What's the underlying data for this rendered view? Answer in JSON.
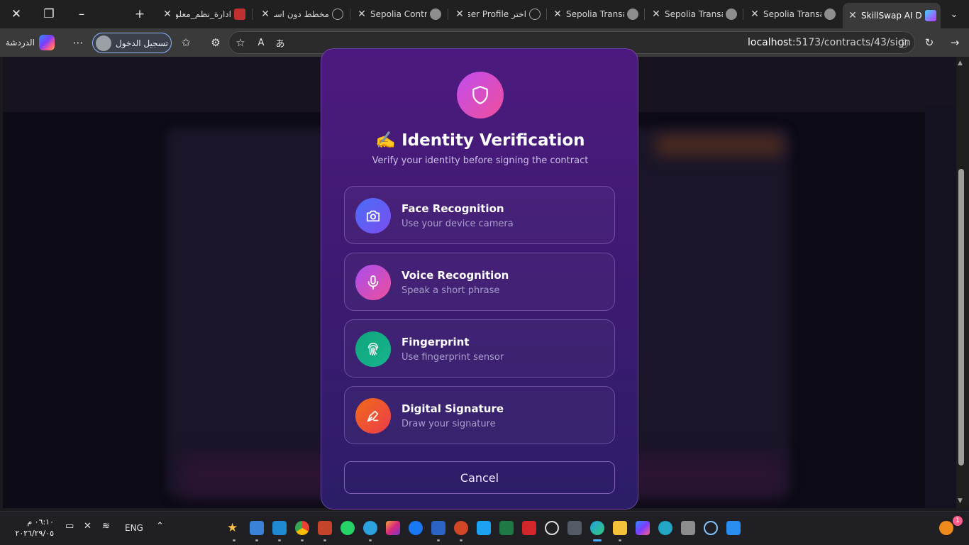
{
  "tabs": [
    {
      "title": "ادارة_نظم_معلومات",
      "rtl": true,
      "favicon": "pdf-icon"
    },
    {
      "title": "مخطط دون اسم_",
      "rtl": true,
      "favicon": "globe-icon"
    },
    {
      "title": "Sepolia Contract",
      "rtl": false,
      "favicon": "etherscan-icon"
    },
    {
      "title": "اختر User Profile",
      "rtl": true,
      "favicon": "globe-icon"
    },
    {
      "title": "Sepolia Transactio",
      "rtl": false,
      "favicon": "etherscan-icon"
    },
    {
      "title": "Sepolia Transactio",
      "rtl": false,
      "favicon": "etherscan-icon"
    },
    {
      "title": "Sepolia Transactio",
      "rtl": false,
      "favicon": "etherscan-icon"
    },
    {
      "title": "SkillSwap AI Das",
      "rtl": false,
      "favicon": "vite-icon",
      "active": true
    }
  ],
  "browser": {
    "chat_label": "الدردشة",
    "signin_label": "تسجيل الدخول",
    "url_host": "localhost",
    "url_path": ":5173/contracts/43/sign"
  },
  "modal": {
    "title": "✍️ Identity Verification",
    "subtitle": "Verify your identity before signing the contract",
    "options": [
      {
        "title": "Face Recognition",
        "subtitle": "Use your device camera",
        "icon": "camera-icon",
        "color_from": "#4a6cf7",
        "color_to": "#7a4ff0"
      },
      {
        "title": "Voice Recognition",
        "subtitle": "Speak a short phrase",
        "icon": "microphone-icon",
        "color_from": "#a94ef0",
        "color_to": "#ec4f9a"
      },
      {
        "title": "Fingerprint",
        "subtitle": "Use fingerprint sensor",
        "icon": "fingerprint-icon",
        "color_from": "#0fa57a",
        "color_to": "#18b58f"
      },
      {
        "title": "Digital Signature",
        "subtitle": "Draw your signature",
        "icon": "pen-icon",
        "color_from": "#f06a1a",
        "color_to": "#ec3d4a"
      }
    ],
    "cancel_label": "Cancel"
  },
  "taskbar": {
    "time": "٠٦:١٠ م",
    "date": "٢٠٢٦/٢٩/٠٥",
    "lang": "ENG",
    "notification_count": "1"
  }
}
